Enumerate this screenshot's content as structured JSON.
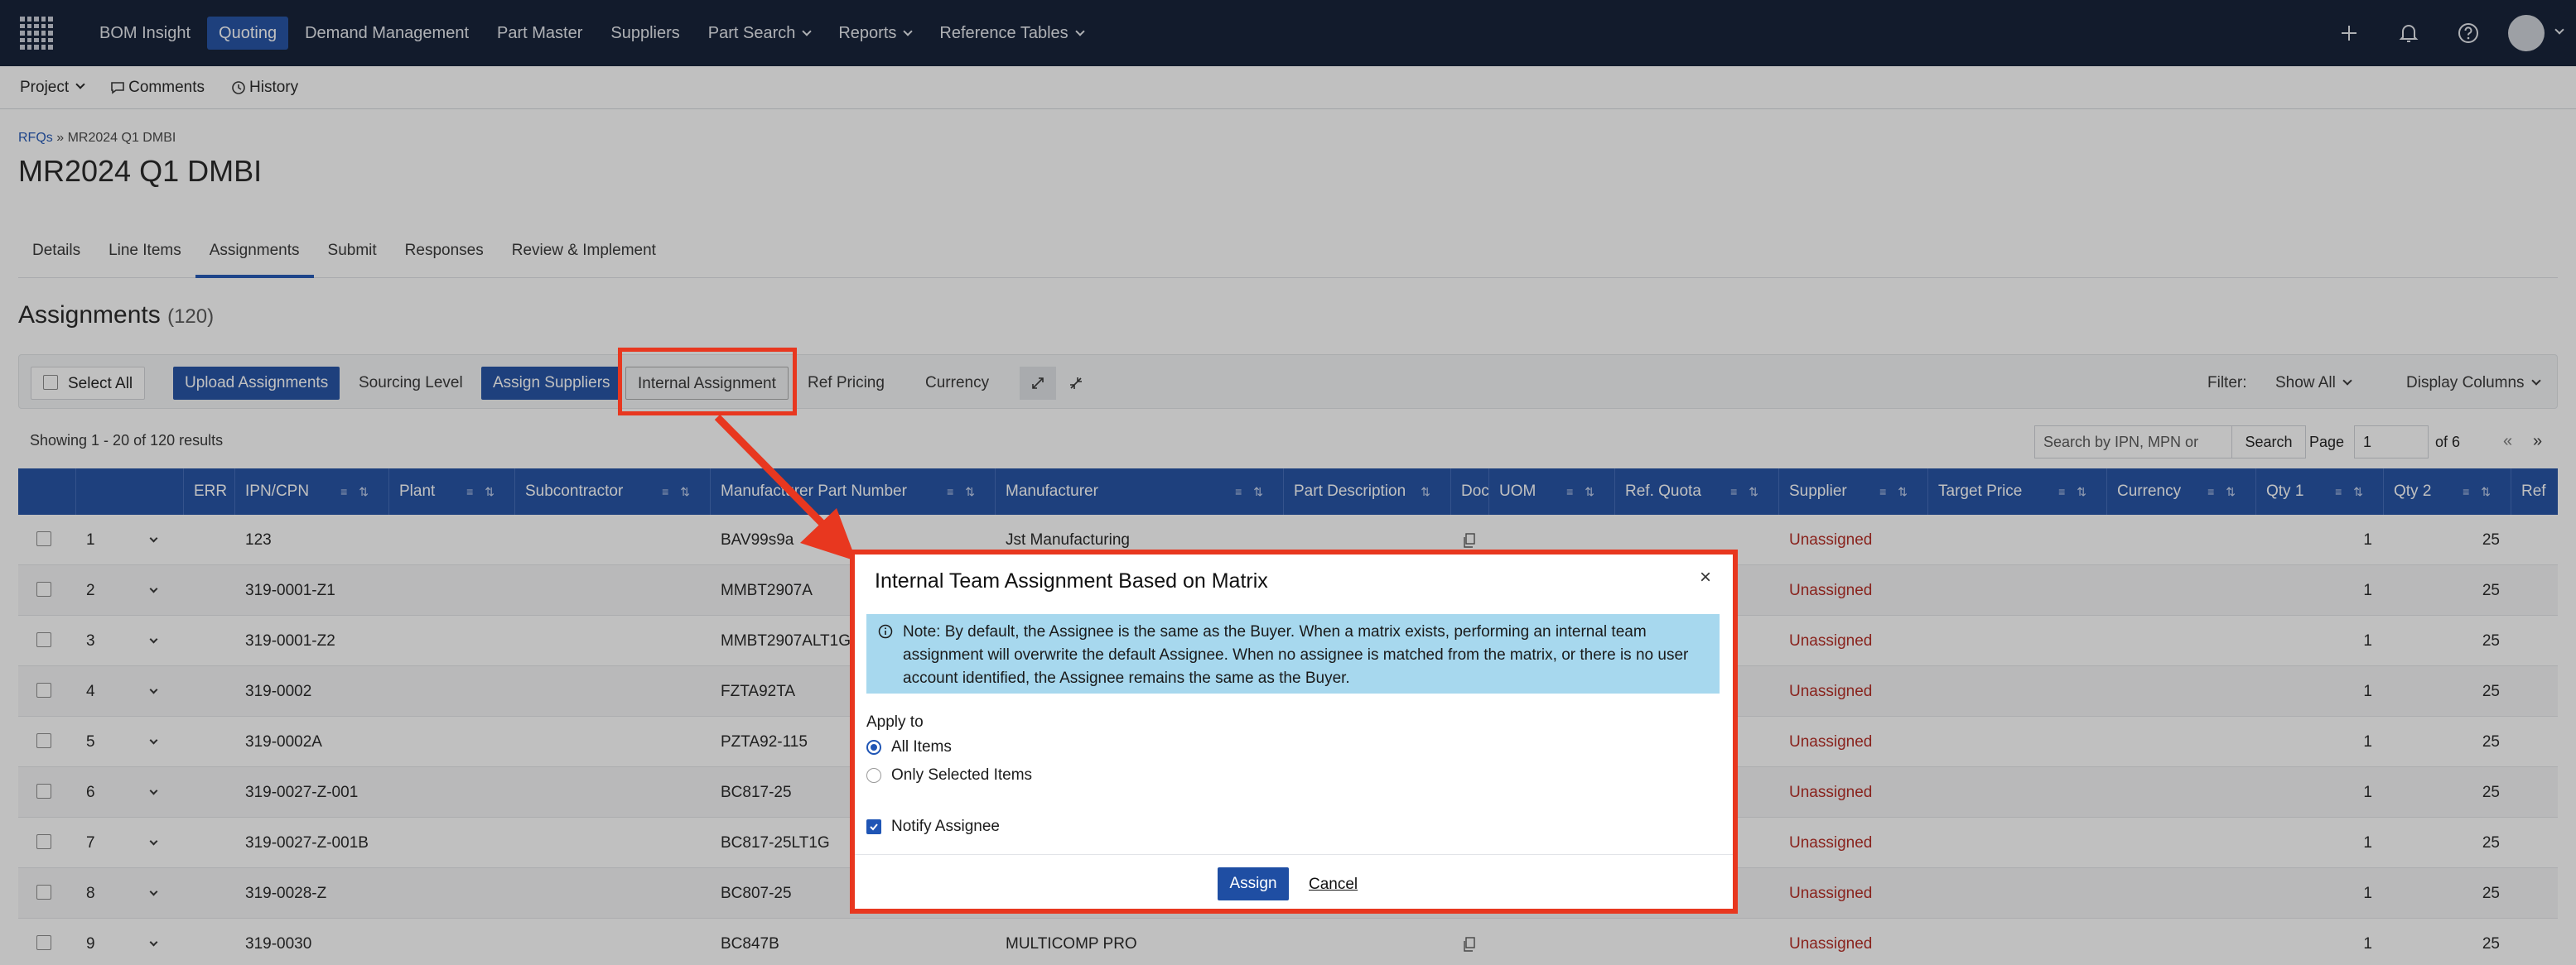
{
  "app": {
    "nav": [
      {
        "label": "BOM Insight",
        "active": false,
        "dropdown": false
      },
      {
        "label": "Quoting",
        "active": true,
        "dropdown": false
      },
      {
        "label": "Demand Management",
        "active": false,
        "dropdown": false
      },
      {
        "label": "Part Master",
        "active": false,
        "dropdown": false
      },
      {
        "label": "Suppliers",
        "active": false,
        "dropdown": false
      },
      {
        "label": "Part Search",
        "active": false,
        "dropdown": true
      },
      {
        "label": "Reports",
        "active": false,
        "dropdown": true
      },
      {
        "label": "Reference Tables",
        "active": false,
        "dropdown": true
      }
    ],
    "nav_icons": [
      "plus-icon",
      "bell-icon",
      "help-icon",
      "avatar"
    ]
  },
  "subbar": {
    "project": "Project",
    "comments": "Comments",
    "history": "History"
  },
  "breadcrumb": {
    "root": "RFQs",
    "sep": "»",
    "current": "MR2024 Q1 DMBI"
  },
  "page": {
    "title": "MR2024 Q1 DMBI"
  },
  "tabs": [
    "Details",
    "Line Items",
    "Assignments",
    "Submit",
    "Responses",
    "Review & Implement"
  ],
  "section": {
    "title": "Assignments",
    "count": "(120)"
  },
  "toolbar": {
    "select_all": "Select All",
    "upload": "Upload Assignments",
    "sourcing_level": "Sourcing Level",
    "assign_suppliers": "Assign Suppliers",
    "internal_assignment": "Internal Assignment",
    "ref_pricing": "Ref Pricing",
    "currency": "Currency",
    "filter_label": "Filter:",
    "filter_value": "Show All",
    "display_columns": "Display Columns"
  },
  "results": {
    "text": "Showing 1 - 20 of 120 results",
    "search_placeholder": "Search by IPN, MPN or",
    "search_button": "Search",
    "page_label": "Page",
    "page_value": "1",
    "of_pages": "of 6",
    "prev": "«",
    "next": "»"
  },
  "table": {
    "columns": [
      "ERR",
      "IPN/CPN",
      "Plant",
      "Subcontractor",
      "Manufacturer Part Number",
      "Manufacturer",
      "Part Description",
      "Doc",
      "UOM",
      "Ref. Quota",
      "Supplier",
      "Target Price",
      "Currency",
      "Qty 1",
      "Qty 2",
      "Ref"
    ],
    "rows": [
      {
        "n": "1",
        "ipn": "123",
        "mpn": "BAV99s9a",
        "mfr": "Jst Manufacturing",
        "supplier": "Unassigned",
        "qty1": "1",
        "qty2": "25"
      },
      {
        "n": "2",
        "ipn": "319-0001-Z1",
        "mpn": "MMBT2907A",
        "mfr": "",
        "supplier": "Unassigned",
        "qty1": "1",
        "qty2": "25"
      },
      {
        "n": "3",
        "ipn": "319-0001-Z2",
        "mpn": "MMBT2907ALT1G",
        "mfr": "",
        "supplier": "Unassigned",
        "qty1": "1",
        "qty2": "25"
      },
      {
        "n": "4",
        "ipn": "319-0002",
        "mpn": "FZTA92TA",
        "mfr": "",
        "supplier": "Unassigned",
        "qty1": "1",
        "qty2": "25"
      },
      {
        "n": "5",
        "ipn": "319-0002A",
        "mpn": "PZTA92-115",
        "mfr": "",
        "supplier": "Unassigned",
        "qty1": "1",
        "qty2": "25"
      },
      {
        "n": "6",
        "ipn": "319-0027-Z-001",
        "mpn": "BC817-25",
        "mfr": "",
        "supplier": "Unassigned",
        "qty1": "1",
        "qty2": "25"
      },
      {
        "n": "7",
        "ipn": "319-0027-Z-001B",
        "mpn": "BC817-25LT1G",
        "mfr": "",
        "supplier": "Unassigned",
        "qty1": "1",
        "qty2": "25"
      },
      {
        "n": "8",
        "ipn": "319-0028-Z",
        "mpn": "BC807-25",
        "mfr": "",
        "supplier": "Unassigned",
        "qty1": "1",
        "qty2": "25"
      },
      {
        "n": "9",
        "ipn": "319-0030",
        "mpn": "BC847B",
        "mfr": "MULTICOMP PRO",
        "supplier": "Unassigned",
        "qty1": "1",
        "qty2": "25"
      }
    ]
  },
  "modal": {
    "title": "Internal Team Assignment Based on Matrix",
    "close": "×",
    "note": "Note: By default, the Assignee is the same as the Buyer. When a matrix exists, performing an internal team assignment will overwrite the default Assignee. When no assignee is matched from the matrix, or there is no user account identified, the Assignee remains the same as the Buyer.",
    "apply_to": "Apply to",
    "option_all": "All Items",
    "option_selected": "Only Selected Items",
    "notify": "Notify Assignee",
    "assign": "Assign",
    "cancel": "Cancel"
  },
  "colors": {
    "nav_bg": "#0f1b33",
    "primary": "#1f4ea3",
    "annotation": "#e8371f",
    "unassigned": "#b3261e",
    "note_bg": "#a7d8ee"
  }
}
